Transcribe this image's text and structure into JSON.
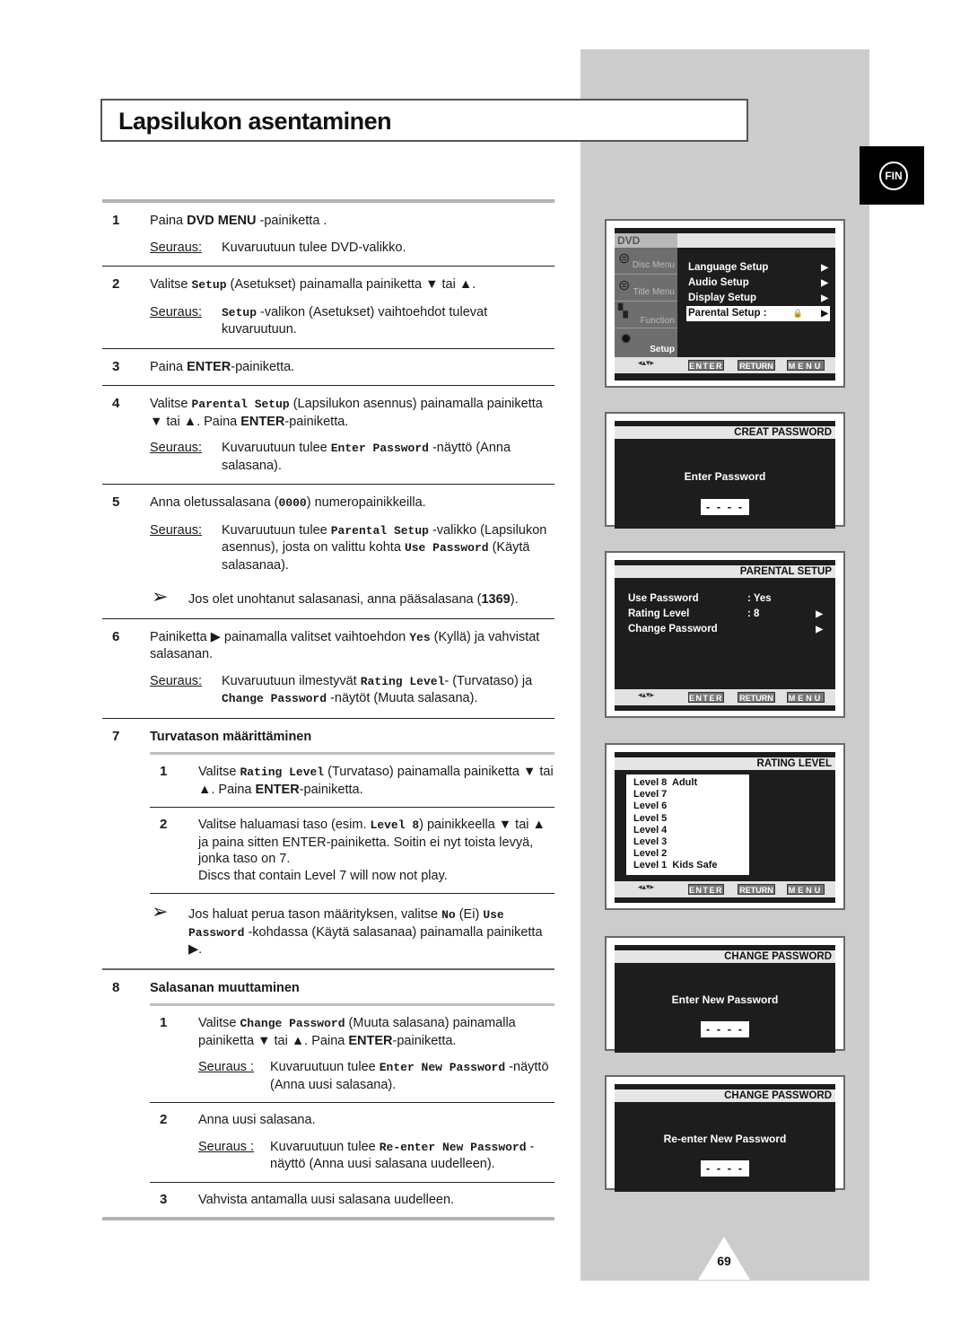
{
  "page": {
    "title": "Lapsilukon asentaminen",
    "language_tab": "FIN",
    "page_number": "69"
  },
  "steps": [
    {
      "num": "1",
      "text_pre": "Paina ",
      "bold": "DVD MENU",
      "text_post": " -painiketta .",
      "result_label": "Seuraus:",
      "result": "Kuvaruutuun tulee DVD-valikko."
    },
    {
      "num": "2",
      "text_pre": "Valitse ",
      "mono": "Setup",
      "text_post": " (Asetukset) painamalla painiketta ▼ tai ▲.",
      "result_label": "Seuraus:",
      "result_mono": "Setup",
      "result": " -valikon (Asetukset) vaihtoehdot tulevat kuvaruutuun."
    },
    {
      "num": "3",
      "text_pre": "Paina ",
      "bold": "ENTER",
      "text_post": "-painiketta."
    },
    {
      "num": "4",
      "text_pre": "Valitse ",
      "mono": "Parental Setup",
      "text_mid": " (Lapsilukon asennus) painamalla painiketta ▼ tai ▲. Paina ",
      "bold": "ENTER",
      "text_post": "-painiketta.",
      "result_label": "Seuraus:",
      "result_pre": "Kuvaruutuun tulee ",
      "result_mono": "Enter Password",
      "result": " -näyttö (Anna salasana)."
    },
    {
      "num": "5",
      "text_pre": "Anna oletussalasana (",
      "mono": "0000",
      "text_post": ") numeropainikkeilla.",
      "result_label": "Seuraus:",
      "result_pre": "Kuvaruutuun tulee ",
      "result_mono": "Parental Setup",
      "result_mid": " -valikko (Lapsilukon asennus), josta on valittu kohta ",
      "result_mono2": "Use Password",
      "result": " (Käytä salasanaa).",
      "note_pre": "Jos olet unohtanut salasanasi, anna pääsalasana (",
      "note_bold": "1369",
      "note_post": ")."
    },
    {
      "num": "6",
      "text_pre": "Painiketta ▶ painamalla valitset vaihtoehdon ",
      "mono": "Yes",
      "text_post": " (Kyllä) ja vahvistat salasanan.",
      "result_label": "Seuraus:",
      "result_pre": "Kuvaruutuun ilmestyvät ",
      "result_mono": "Rating Level",
      "result_mid": "- (Turvataso) ja ",
      "result_mono2": "Change Password",
      "result": " -näytöt (Muuta salasana)."
    },
    {
      "num": "7",
      "heading": "Turvatason määrittäminen",
      "substeps": [
        {
          "num": "1",
          "text_pre": "Valitse ",
          "mono": "Rating Level",
          "text_mid": " (Turvataso) painamalla painiketta ▼ tai ▲. Paina ",
          "bold": "ENTER",
          "text_post": "-painiketta."
        },
        {
          "num": "2",
          "text_pre": "Valitse haluamasi taso (esim. ",
          "mono": "Level 8",
          "text_post": ") painikkeella ▼ tai ▲ ja paina sitten ENTER-painiketta. Soitin ei nyt toista levyä, jonka taso on 7.",
          "extra": "Discs that contain Level 7 will now not play."
        }
      ],
      "note_pre": "Jos haluat perua tason määrityksen, valitse ",
      "note_mono": "No",
      "note_mid": " (Ei) ",
      "note_mono2": "Use Password",
      "note_post": " -kohdassa (Käytä salasanaa) painamalla painiketta ▶."
    },
    {
      "num": "8",
      "heading": "Salasanan muuttaminen",
      "substeps": [
        {
          "num": "1",
          "text_pre": "Valitse ",
          "mono": "Change Password",
          "text_mid": " (Muuta salasana) painamalla painiketta ▼ tai ▲. Paina ",
          "bold": "ENTER",
          "text_post": "-painiketta.",
          "result_label": "Seuraus :",
          "result_pre": "Kuvaruutuun tulee ",
          "result_mono": "Enter New Password",
          "result": " -näyttö (Anna uusi salasana)."
        },
        {
          "num": "2",
          "text_pre": "Anna uusi salasana.",
          "result_label": "Seuraus :",
          "result_pre": "Kuvaruutuun tulee ",
          "result_mono": "Re-enter New Password",
          "result": " -näyttö (Anna uusi salasana uudelleen)."
        },
        {
          "num": "3",
          "text_pre": "Vahvista antamalla uusi salasana uudelleen."
        }
      ]
    }
  ],
  "screens": {
    "nav": {
      "enter": "ENTER",
      "return": "RETURN",
      "menu": "MENU",
      "arrows": "◂▴▾▸"
    },
    "dvd_menu": {
      "brand": "DVD",
      "left_items": [
        "Disc Menu",
        "Title Menu",
        "Function",
        "Setup"
      ],
      "items": [
        {
          "label": "Language Setup",
          "arrow": "▶"
        },
        {
          "label": "Audio Setup",
          "arrow": "▶"
        },
        {
          "label": "Display Setup",
          "arrow": "▶"
        },
        {
          "label": "Parental Setup :",
          "arrow": "▶",
          "lock": "🔒",
          "selected": true
        }
      ]
    },
    "creat_password": {
      "header": "CREAT PASSWORD",
      "label": "Enter Password",
      "input": "- - - -"
    },
    "parental_setup": {
      "header": "PARENTAL SETUP",
      "rows": [
        {
          "label": "Use Password",
          "value": ": Yes",
          "arrow": ""
        },
        {
          "label": "Rating Level",
          "value": ": 8",
          "arrow": "▶"
        },
        {
          "label": "Change Password",
          "value": "",
          "arrow": "▶"
        }
      ]
    },
    "rating_level": {
      "header": "RATING LEVEL",
      "levels": [
        "Level 8  Adult",
        "Level 7",
        "Level 6",
        "Level 5",
        "Level 4",
        "Level 3",
        "Level 2",
        "Level 1  Kids Safe"
      ]
    },
    "change_password_1": {
      "header": "CHANGE PASSWORD",
      "label": "Enter New Password",
      "input": "- - - -"
    },
    "change_password_2": {
      "header": "CHANGE PASSWORD",
      "label": "Re-enter New Password",
      "input": "- - - -"
    }
  }
}
